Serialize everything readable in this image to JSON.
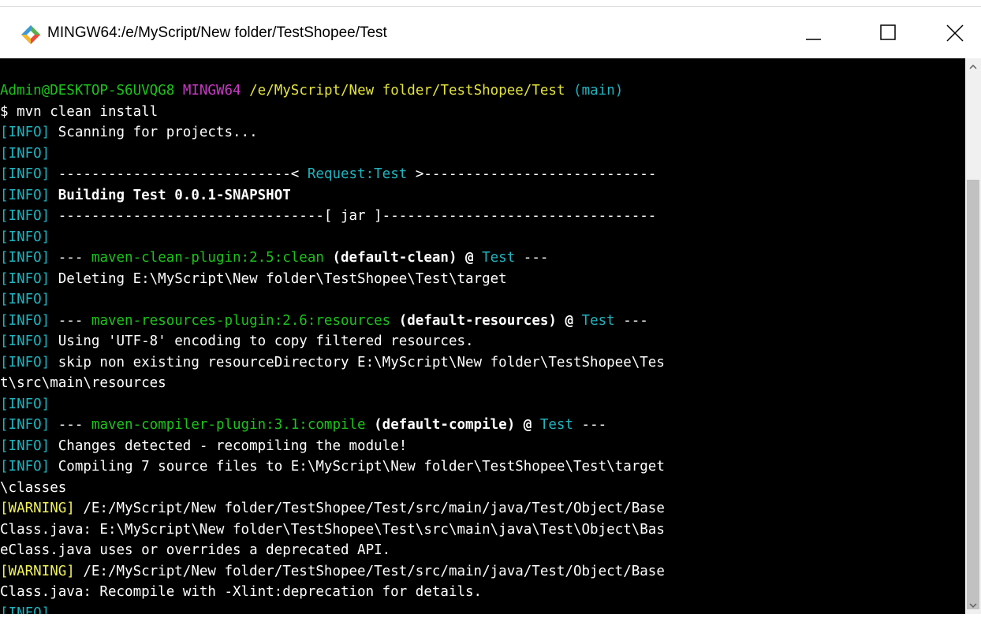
{
  "window": {
    "title": "MINGW64:/e/MyScript/New folder/TestShopee/Test",
    "icon": "git-bash-icon",
    "controls": [
      "minimize-icon",
      "maximize-icon",
      "close-icon"
    ]
  },
  "prompt": {
    "user": "Admin@DESKTOP-S6UVQG8",
    "env": "MINGW64",
    "path": "/e/MyScript/New folder/TestShopee/Test",
    "branch": "(main)",
    "command": "$ mvn clean install"
  },
  "log": {
    "info": "[INFO]",
    "warning": "[WARNING]",
    "l1": " Scanning for projects...",
    "l3a": " ----------------------------< ",
    "l3b": "Request:Test",
    "l3c": " >----------------------------",
    "l4": " Building Test 0.0.1-SNAPSHOT",
    "l5": " --------------------------------[ jar ]---------------------------------",
    "l7a": " --- ",
    "l7b": "maven-clean-plugin:2.5:clean",
    "l7c": " (default-clean) @ ",
    "l7d": "Test",
    "l7e": " ---",
    "l8": " Deleting E:\\MyScript\\New folder\\TestShopee\\Test\\target",
    "l10a": " --- ",
    "l10b": "maven-resources-plugin:2.6:resources",
    "l10c": " (default-resources) @ ",
    "l10d": "Test",
    "l10e": " ---",
    "l11": " Using 'UTF-8' encoding to copy filtered resources.",
    "l12": " skip non existing resourceDirectory E:\\MyScript\\New folder\\TestShopee\\Tes",
    "l13": "t\\src\\main\\resources",
    "l15a": " --- ",
    "l15b": "maven-compiler-plugin:3.1:compile",
    "l15c": " (default-compile) @ ",
    "l15d": "Test",
    "l15e": " ---",
    "l16": " Changes detected - recompiling the module!",
    "l17": " Compiling 7 source files to E:\\MyScript\\New folder\\TestShopee\\Test\\target",
    "l18": "\\classes",
    "l19": " /E:/MyScript/New folder/TestShopee/Test/src/main/java/Test/Object/Base",
    "l20": "Class.java: E:\\MyScript\\New folder\\TestShopee\\Test\\src\\main\\java\\Test\\Object\\Bas",
    "l21": "eClass.java uses or overrides a deprecated API.",
    "l22": " /E:/MyScript/New folder/TestShopee/Test/src/main/java/Test/Object/Base",
    "l23": "Class.java: Recompile with -Xlint:deprecation for details."
  },
  "colors": {
    "info": "#1fb4bf",
    "warning": "#f0f05a",
    "plugin": "#1cc31c",
    "user": "#1cc31c",
    "env": "#c839c5",
    "path": "#e4e43c",
    "branch": "#1fb4bf"
  }
}
